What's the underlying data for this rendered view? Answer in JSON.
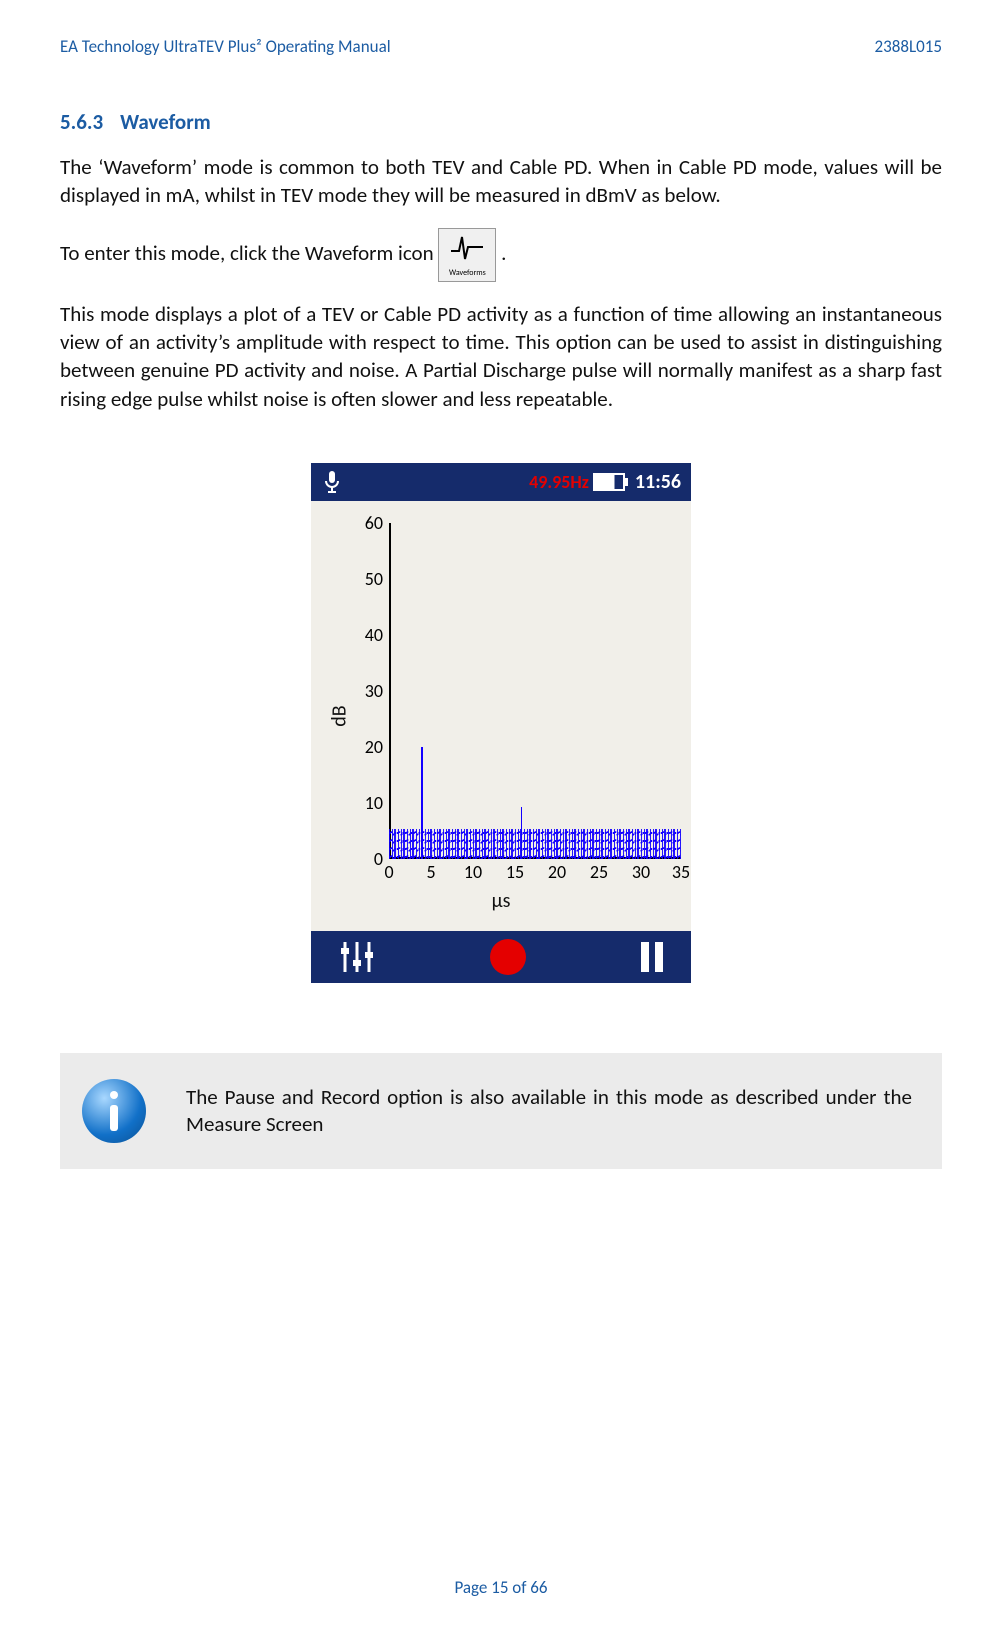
{
  "header": {
    "doc_title": "EA Technology UltraTEV Plus² Operating Manual",
    "doc_code": "2388L015"
  },
  "section": {
    "number": "5.6.3",
    "title": "Waveform"
  },
  "paragraphs": {
    "p1": "The ‘Waveform’ mode is common to both TEV and Cable PD. When in Cable PD mode, values will be displayed in mA, whilst in TEV mode they will be measured in dBmV as below.",
    "p2_pre": "To enter this mode, click the Waveform icon ",
    "p2_post": ".",
    "p3": "This mode displays a plot of a TEV or Cable PD activity as a function of time allowing an instantaneous view of an activity’s amplitude with respect to time. This option can be used to assist in distinguishing between genuine PD activity and noise. A Partial Discharge pulse will normally manifest as a sharp fast rising edge pulse whilst noise is often slower and less repeatable."
  },
  "mini_icon": {
    "label": "Waveforms"
  },
  "device": {
    "freq": "49.95Hz",
    "time": "11:56",
    "ylabel": "dB",
    "xlabel": "μs"
  },
  "chart_data": {
    "type": "line",
    "title": "",
    "xlabel": "μs",
    "ylabel": "dB",
    "xlim": [
      0,
      35
    ],
    "ylim": [
      0,
      60
    ],
    "x_ticks": [
      0,
      5,
      10,
      15,
      20,
      25,
      30,
      35
    ],
    "y_ticks": [
      0,
      10,
      20,
      30,
      40,
      50,
      60
    ],
    "series": [
      {
        "name": "noise-floor",
        "approx": true,
        "values_note": "random noise band roughly 0–5 dB across full x range"
      },
      {
        "name": "pd-spike-main",
        "x": 4,
        "peak_db": 20
      },
      {
        "name": "pd-spike-small",
        "x": 16,
        "peak_db": 8
      }
    ]
  },
  "note": {
    "text": "The Pause and Record option is also available in this mode as described under the Measure Screen"
  },
  "footer": {
    "page_label": "Page 15 of 66"
  }
}
